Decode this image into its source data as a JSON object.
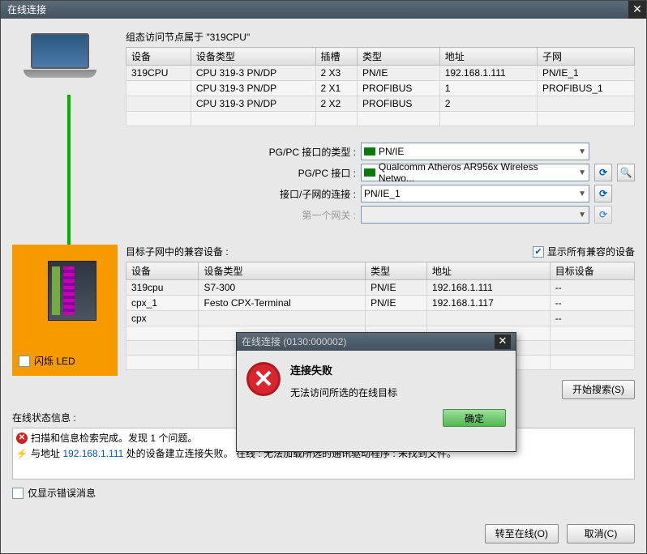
{
  "window_title": "在线连接",
  "config_caption": "组态访问节点属于 \"319CPU\"",
  "config_table": {
    "headers": [
      "设备",
      "设备类型",
      "插槽",
      "类型",
      "地址",
      "子网"
    ],
    "rows": [
      [
        "319CPU",
        "CPU 319-3 PN/DP",
        "2 X3",
        "PN/IE",
        "192.168.1.111",
        "PN/IE_1"
      ],
      [
        "",
        "CPU 319-3 PN/DP",
        "2 X1",
        "PROFIBUS",
        "1",
        "PROFIBUS_1"
      ],
      [
        "",
        "CPU 319-3 PN/DP",
        "2 X2",
        "PROFIBUS",
        "2",
        ""
      ]
    ]
  },
  "form": {
    "if_type_label": "PG/PC 接口的类型 :",
    "if_type_value": "PN/IE",
    "if_label": "PG/PC 接口 :",
    "if_value": "Qualcomm Atheros AR956x Wireless Netwo...",
    "conn_label": "接口/子网的连接 :",
    "conn_value": "PN/IE_1",
    "gw_label": "第一个网关 :",
    "gw_value": ""
  },
  "compat_caption": "目标子网中的兼容设备 :",
  "show_all_label": "显示所有兼容的设备",
  "compat_table": {
    "headers": [
      "设备",
      "设备类型",
      "类型",
      "地址",
      "目标设备"
    ],
    "rows": [
      [
        "319cpu",
        "S7-300",
        "PN/IE",
        "192.168.1.111",
        "--"
      ],
      [
        "cpx_1",
        "Festo CPX-Terminal",
        "PN/IE",
        "192.168.1.117",
        "--"
      ],
      [
        "cpx",
        "",
        "",
        "",
        "--"
      ]
    ]
  },
  "empty4": "",
  "flash_led_label": "闪烁 LED",
  "start_search_btn": "开始搜索(S)",
  "status_caption": "在线状态信息 :",
  "status_rows": [
    "扫描和信息检索完成。发现 1 个问题。"
  ],
  "status_msg2_prefix": "与地址 ",
  "status_msg2_addr": "192.168.1.111",
  "status_msg2_suffix": " 处的设备建立连接失败。 在线 : 无法加载所选的通讯驱动程序 : 未找到文件。",
  "only_errors_label": "仅显示错误消息",
  "go_online_btn": "转至在线(O)",
  "cancel_btn": "取消(C)",
  "dialog": {
    "title": "在线连接 (0130:000002)",
    "heading": "连接失败",
    "message": "无法访问所选的在线目标",
    "ok": "确定"
  }
}
